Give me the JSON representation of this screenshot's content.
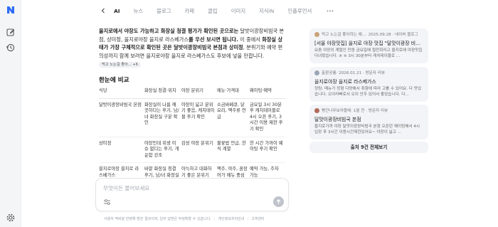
{
  "tabs": [
    {
      "label": "AI",
      "active": true
    },
    {
      "label": "뉴스"
    },
    {
      "label": "블로그"
    },
    {
      "label": "카페"
    },
    {
      "label": "클립"
    },
    {
      "label": "이미지"
    },
    {
      "label": "지식iN"
    },
    {
      "label": "인플루언서"
    }
  ],
  "answer": {
    "p1": "을지로에서 야장도 가능하고 화장실 청결 평가가 확인된 곳으로는",
    "p2": " 달밧이광장비빔국 본점, 상미정, 을지로야장 을지로 라스베가스",
    "p3": "를 우선 보시면 됩니다.",
    "p4": " 이 중에서 ",
    "p5": "화장실 상태가 가장 구체적으로 확인된 곳은 달밧이광장비빔국 본점과 상미정",
    "p6": ", 분위기와 예약 편의성까지 함께 보려면 을지로야장 을지로 라스베가스도 후보에 넣을 만합니다.",
    "chip": "먹고 노는걸 좋아... +6"
  },
  "section_title": "한눈에 비교",
  "table": {
    "headers": [
      "식당",
      "화장실 청결·위치",
      "야장 분위기",
      "메뉴·가격대",
      "웨이팅·예약"
    ],
    "rows": [
      [
        "달밧이광장비빔국 본점",
        "화장실이 나름 깨끗하다는 후기, 남/녀 화장실 구분 확인",
        "야장이 넓고 분위기 좋음, 캐치테이블 후기 확인",
        "소금바베큐, 닭요리, 맥주류 언급",
        "금요일 3시 30분 후 캐치테이블로 4시 오픈 후기, 3시간 이용 제한 후기 확인"
      ],
      [
        "상미정",
        "야장인데 위생 이슈 없다는 후기, 개운함 강조",
        "감성 야장 분위기",
        "불꽃밥 언급, 한식 계열",
        "한 시간 가까이 웨이팅 후기 확인"
      ],
      [
        "을지로야장 을지로 라스베가스",
        "바깥 화장실 청결 후기, 남/녀 화장실 구분 확인",
        "아늑하고 대화하기 좋은 분위기",
        "맥주, 야주, 꼼장어가 메뉴 중심",
        "예약 가능, 주차 가능"
      ]
    ]
  },
  "composer": {
    "placeholder": "무엇이든 물어보세요"
  },
  "footer": {
    "note": "사용자 맥락을 반영해 범한 결과이며, 일부 답변은 부정확할 수 있습니다.",
    "privacy": "개인정보처리안내",
    "center": "고객센터"
  },
  "sources": [
    {
      "author": "먹고 노는걸 좋아하는 예...",
      "meta": "· 2025.09.28 · 네이버 블로그",
      "title": "[서울 야장맛집] 을지로 야장 맛집 \"달맛이광장 비빔국...",
      "snippet": "요즘 야장의 계절인 만큼 금요일에 절찬회라고 을지로에 야장맛집 다녀왔습니다. ※ ※ 3시 30분부터 캐치테이블로 ...",
      "dot_color": "#c9a27a"
    },
    {
      "author": "출판공룡",
      "meta": "· 2026.01.21 · 방문자 리뷰",
      "title": "을지로야장 을지로 라스베가스",
      "snippet": "정림: 메뉴가 정형 다양해서 취향에 따라 고를 수 있어요. 다 맛있습니다. 오이라빠로서 오이 안주 있어서 좋았습니다. 다...",
      "dot_color": "#9aa4b5"
    },
    {
      "author": "빵간나무보라블해",
      "meta": "· 1월 전 · 방문자 리뷰",
      "title": "달맛이광장비빔국 본점",
      "snippet": "을지로가까 야장 달맛이광장비빔국 본점 오픈런 웨이팅해서 4시 입장 후 3시간 이용시간제한있어요~ 야장이 넓고 ...",
      "dot_color": "#b06a5c"
    }
  ],
  "all_sources_label": "출처 9건 전체보기",
  "colors": {
    "accent": "#1f2a44",
    "logo": "#2f6df6",
    "panel": "#f3f4f7"
  }
}
